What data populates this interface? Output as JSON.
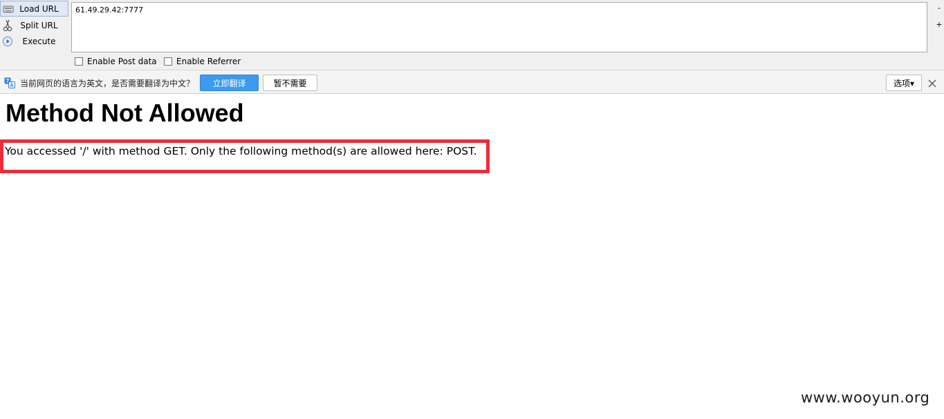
{
  "hackbar": {
    "load_url_label": "Load URL",
    "split_url_label": "Split URL",
    "execute_label": "Execute",
    "url_value": "61.49.29.42:7777",
    "zoom_out_label": "-",
    "zoom_in_label": "+",
    "enable_post_label": "Enable Post data",
    "enable_referrer_label": "Enable Referrer",
    "icons": {
      "load": "load-url-icon",
      "split": "scissors-icon",
      "execute": "play-icon"
    }
  },
  "translate_bar": {
    "message": "当前网页的语言为英文，是否需要翻译为中文？",
    "translate_label": "立即翻译",
    "not_now_label": "暂不需要",
    "options_label": "选项▾",
    "accent_color": "#3c9af0"
  },
  "page": {
    "title": "Method Not Allowed",
    "message": "You accessed '/' with method GET. Only the following method(s) are allowed here: POST.",
    "highlight_color": "#ef2b3a"
  },
  "watermark": "www.wooyun.org"
}
